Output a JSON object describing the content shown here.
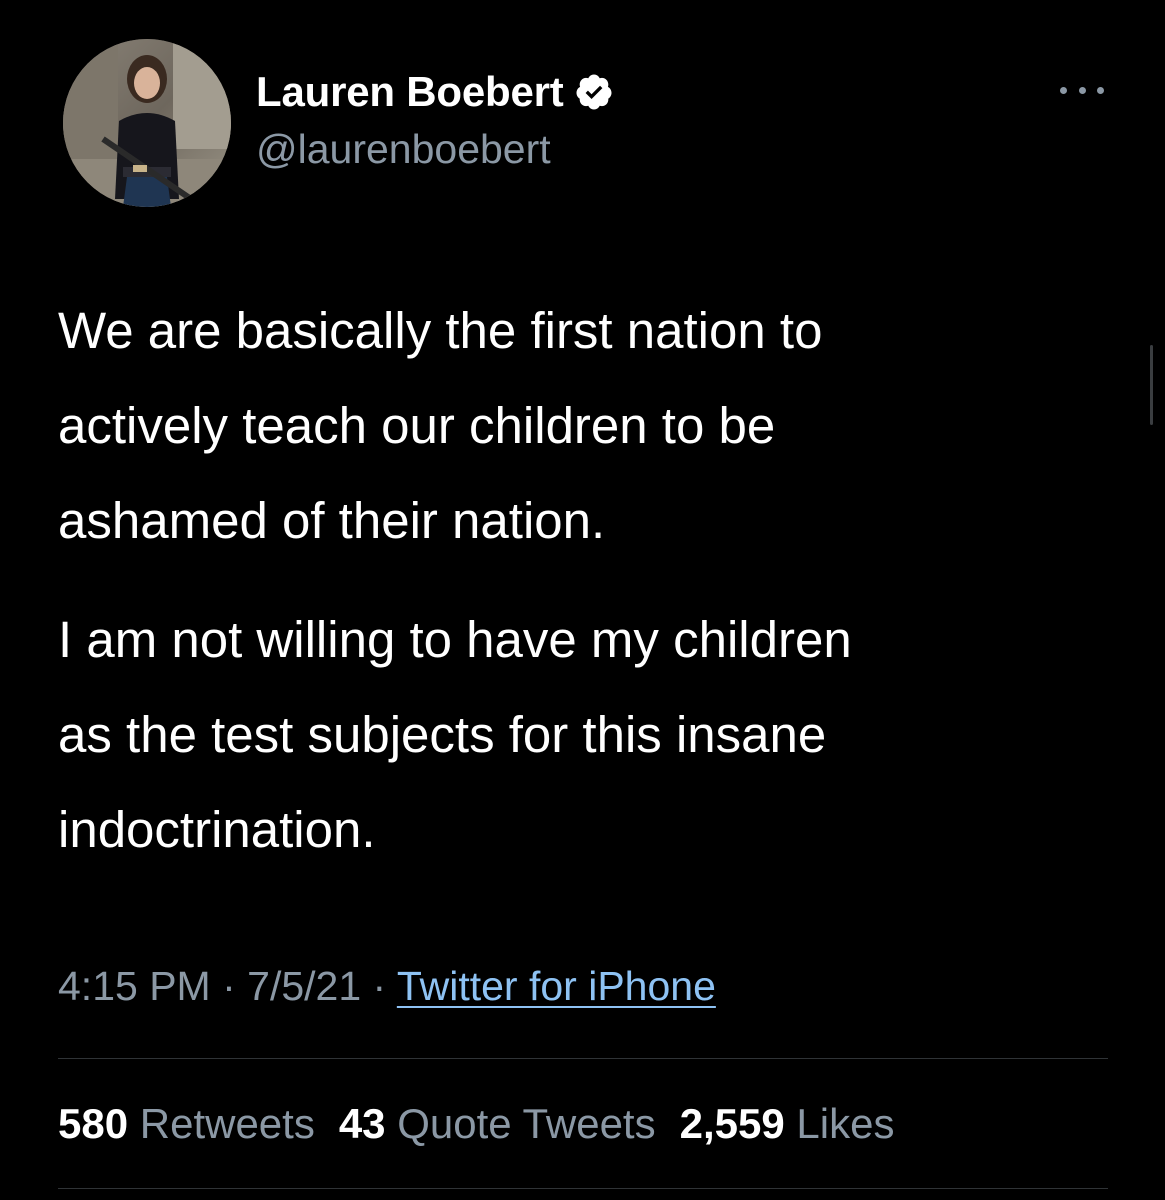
{
  "author": {
    "display_name": "Lauren Boebert",
    "handle": "@laurenboebert",
    "verified": true
  },
  "icons": {
    "verified": "verified-badge-icon",
    "more": "more-options-icon"
  },
  "tweet": {
    "paragraph1": [
      "We are basically the first nation to",
      "actively teach our children to be",
      "ashamed of their nation."
    ],
    "paragraph2": [
      "I am not willing to have my children",
      "as the test subjects for this insane",
      "indoctrination."
    ]
  },
  "meta": {
    "time": "4:15 PM",
    "separator": " · ",
    "date": "7/5/21",
    "source": "Twitter for iPhone"
  },
  "stats": {
    "retweets": {
      "count": "580",
      "label": "Retweets"
    },
    "quote_tweets": {
      "count": "43",
      "label": "Quote Tweets"
    },
    "likes": {
      "count": "2,559",
      "label": "Likes"
    }
  },
  "colors": {
    "background": "#000000",
    "primary_text": "#ffffff",
    "secondary_text": "#8b98a5",
    "link": "#8ec2f3",
    "divider": "#2f3336"
  }
}
